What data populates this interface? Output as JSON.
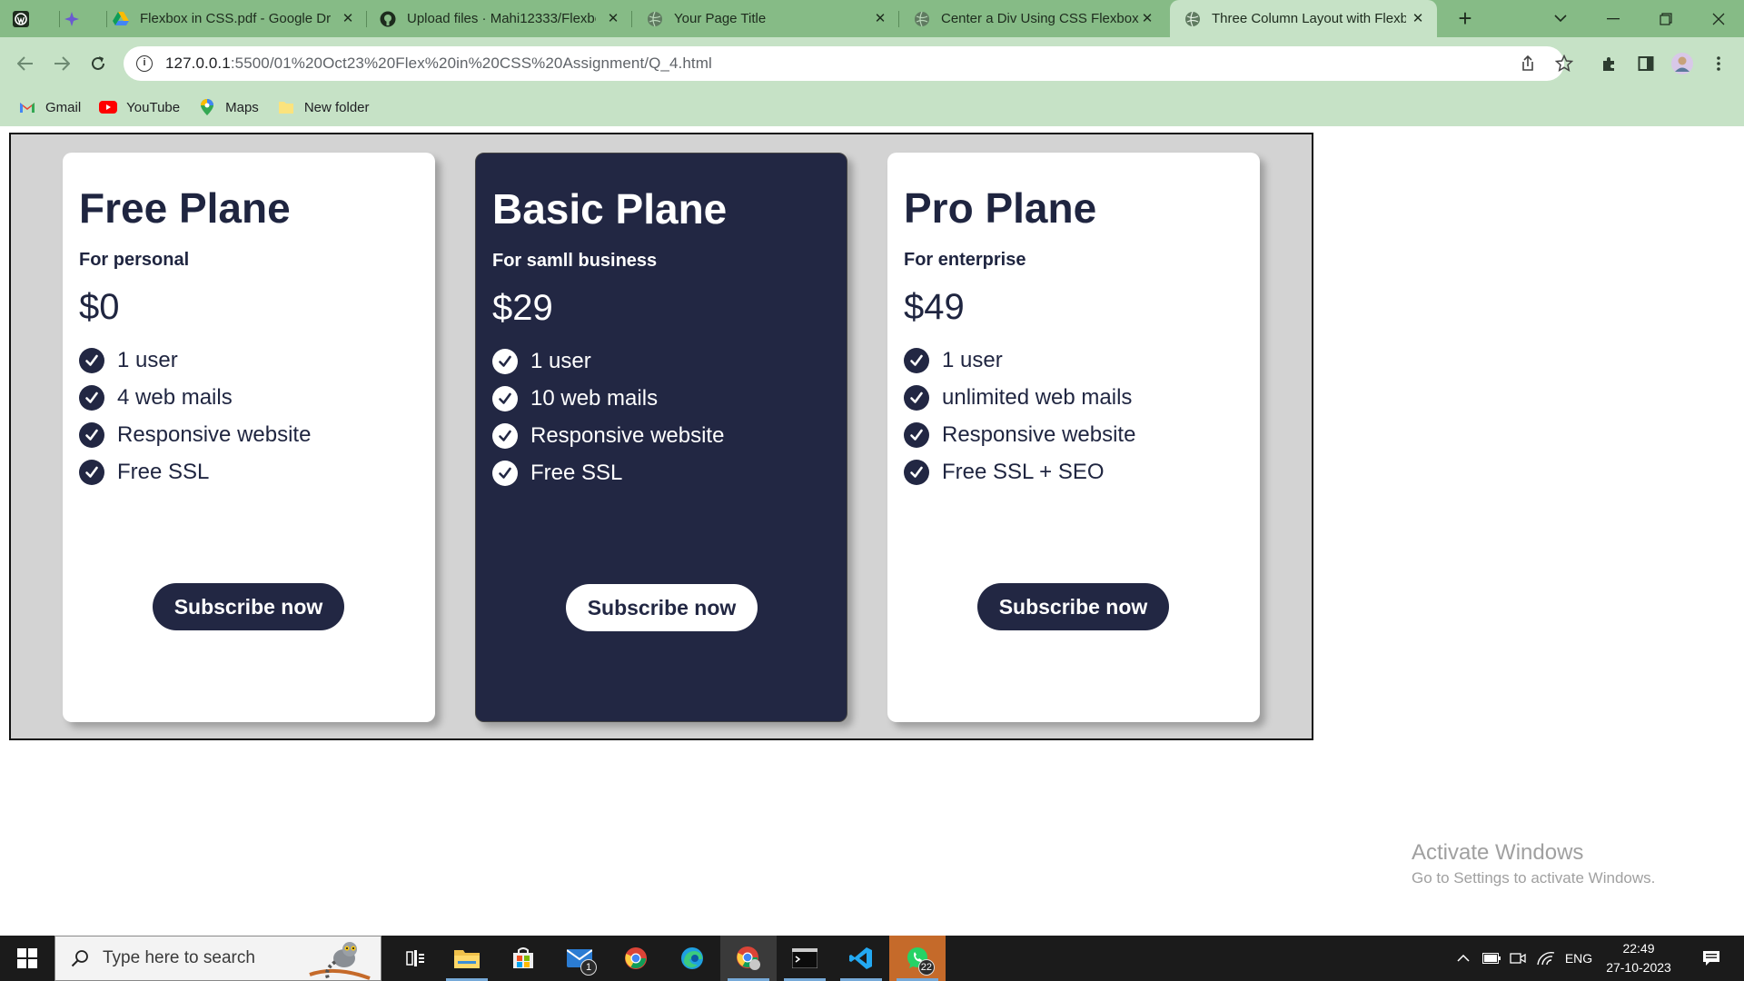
{
  "browser": {
    "tabs": [
      {
        "title": "",
        "icon": "wordpress-icon"
      },
      {
        "title": "",
        "icon": "sparkle-icon"
      },
      {
        "title": "Flexbox in CSS.pdf - Google Dri",
        "icon": "google-drive-icon"
      },
      {
        "title": "Upload files · Mahi12333/Flexbo",
        "icon": "github-icon"
      },
      {
        "title": "Your Page Title",
        "icon": "globe-icon"
      },
      {
        "title": "Center a Div Using CSS Flexbox",
        "icon": "globe-icon"
      },
      {
        "title": "Three Column Layout with Flexb",
        "icon": "globe-icon",
        "active": true
      }
    ],
    "url_host": "127.0.0.1",
    "url_rest": ":5500/01%20Oct23%20Flex%20in%20CSS%20Assignment/Q_4.html",
    "bookmarks": [
      {
        "label": "Gmail",
        "icon": "gmail-icon"
      },
      {
        "label": "YouTube",
        "icon": "youtube-icon"
      },
      {
        "label": "Maps",
        "icon": "maps-icon"
      },
      {
        "label": "New folder",
        "icon": "folder-icon"
      }
    ]
  },
  "plans": [
    {
      "name": "Free Plane",
      "subtitle": "For personal",
      "price": "$0",
      "features": [
        "1 user",
        "4 web mails",
        "Responsive website",
        "Free SSL"
      ],
      "button": "Subscribe now",
      "theme": "light"
    },
    {
      "name": "Basic Plane",
      "subtitle": "For samll business",
      "price": "$29",
      "features": [
        "1 user",
        "10 web mails",
        "Responsive website",
        "Free SSL"
      ],
      "button": "Subscribe now",
      "theme": "dark"
    },
    {
      "name": "Pro Plane",
      "subtitle": "For enterprise",
      "price": "$49",
      "features": [
        "1 user",
        "unlimited web mails",
        "Responsive website",
        "Free SSL + SEO"
      ],
      "button": "Subscribe now",
      "theme": "light"
    }
  ],
  "watermark": {
    "line1": "Activate Windows",
    "line2": "Go to Settings to activate Windows."
  },
  "taskbar": {
    "search_placeholder": "Type here to search",
    "mail_badge": "1",
    "whatsapp_badge": "22",
    "language": "ENG",
    "time": "22:49",
    "date": "27-10-2023"
  },
  "colors": {
    "tab_bar": "#86bb86",
    "toolbar": "#c6e2c6",
    "card_dark": "#222743",
    "container_bg": "#d3d3d3"
  }
}
